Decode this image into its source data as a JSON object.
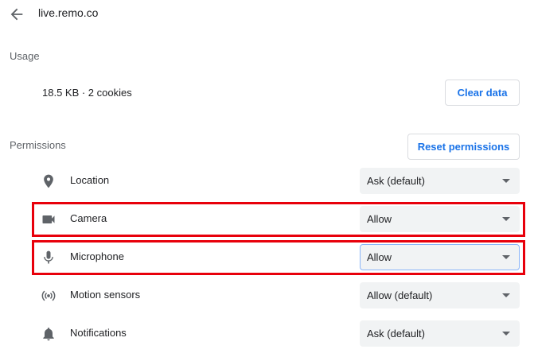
{
  "header": {
    "site": "live.remo.co",
    "back_icon": "arrow-back-icon"
  },
  "usage": {
    "section_label": "Usage",
    "summary": "18.5 KB · 2 cookies",
    "clear_button": "Clear data"
  },
  "permissions": {
    "section_label": "Permissions",
    "reset_button": "Reset permissions",
    "items": [
      {
        "label": "Location",
        "value": "Ask (default)",
        "icon": "location-pin-icon"
      },
      {
        "label": "Camera",
        "value": "Allow",
        "icon": "camera-icon",
        "highlighted": true
      },
      {
        "label": "Microphone",
        "value": "Allow",
        "icon": "microphone-icon",
        "highlighted": true,
        "focused": true
      },
      {
        "label": "Motion sensors",
        "value": "Allow (default)",
        "icon": "motion-sensors-icon"
      },
      {
        "label": "Notifications",
        "value": "Ask (default)",
        "icon": "bell-icon"
      }
    ]
  },
  "colors": {
    "accent": "#1a73e8",
    "highlight_border": "#e8000b",
    "select_bg": "#f1f3f4",
    "secondary_text": "#5f6368"
  }
}
